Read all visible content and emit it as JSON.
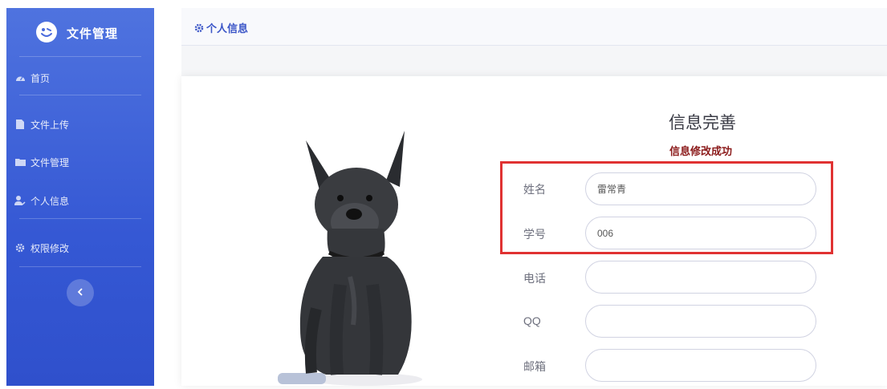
{
  "sidebar": {
    "brand": {
      "title": "文件管理",
      "icon": "smiley-icon"
    },
    "items": [
      {
        "label": "首页",
        "icon": "dashboard-icon"
      },
      {
        "label": "文件上传",
        "icon": "file-icon"
      },
      {
        "label": "文件管理",
        "icon": "folder-icon"
      },
      {
        "label": "个人信息",
        "icon": "user-icon"
      },
      {
        "label": "权限修改",
        "icon": "gear-icon"
      }
    ],
    "toggle_icon": "chevron-left-icon"
  },
  "header": {
    "title": "个人信息",
    "icon": "gear-icon"
  },
  "form": {
    "title": "信息完善",
    "success_message": "信息修改成功",
    "fields": [
      {
        "label": "姓名",
        "value": "雷常青"
      },
      {
        "label": "学号",
        "value": "006"
      },
      {
        "label": "电话",
        "value": ""
      },
      {
        "label": "QQ",
        "value": ""
      },
      {
        "label": "邮箱",
        "value": ""
      }
    ]
  },
  "colors": {
    "sidebar_top": "#4f73df",
    "sidebar_bottom": "#2f50cc",
    "header_text": "#3a55c7",
    "success_text": "#8b1a1a",
    "highlight_border": "#e03232"
  }
}
